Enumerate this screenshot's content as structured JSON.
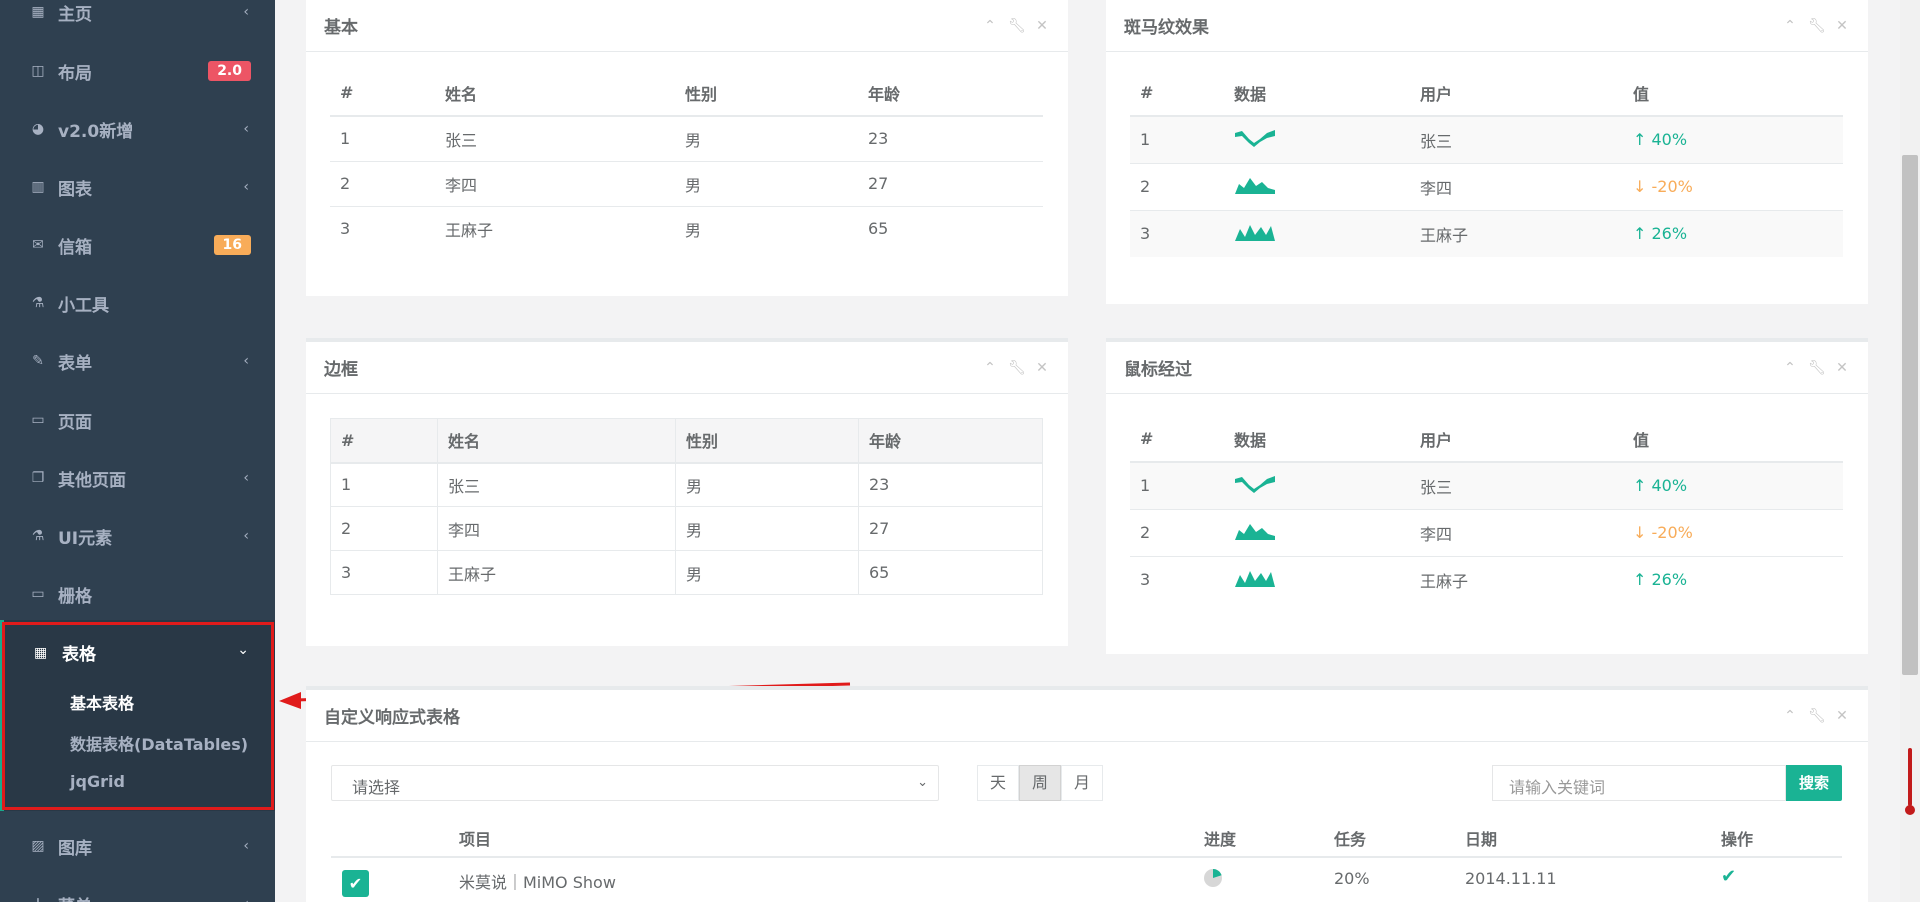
{
  "sidebar": {
    "items": [
      {
        "label": "主页",
        "icon": "grid-icon",
        "chevron": true
      },
      {
        "label": "布局",
        "icon": "columns-icon",
        "badge": "2.0",
        "badge_color": "#ed5565"
      },
      {
        "label": "v2.0新增",
        "icon": "globe-icon",
        "chevron": true
      },
      {
        "label": "图表",
        "icon": "bar-chart-icon",
        "chevron": true
      },
      {
        "label": "信箱",
        "icon": "envelope-icon",
        "badge": "16",
        "badge_color": "#f8ac59"
      },
      {
        "label": "小工具",
        "icon": "flask-icon"
      },
      {
        "label": "表单",
        "icon": "edit-icon",
        "chevron": true
      },
      {
        "label": "页面",
        "icon": "desktop-icon"
      },
      {
        "label": "其他页面",
        "icon": "files-icon",
        "chevron": true
      },
      {
        "label": "UI元素",
        "icon": "flask-icon",
        "chevron": true
      },
      {
        "label": "栅格",
        "icon": "laptop-icon"
      }
    ],
    "active": {
      "label": "表格",
      "icon": "table-icon",
      "children": [
        "基本表格",
        "数据表格(DataTables)",
        "jqGrid"
      ],
      "selected": "基本表格"
    },
    "after": [
      {
        "label": "图库",
        "icon": "picture-icon",
        "chevron": true
      },
      {
        "label": "菜单",
        "icon": "sitemap-icon",
        "chevron": true
      }
    ]
  },
  "panels": {
    "basic": {
      "title": "基本",
      "headers": [
        "#",
        "姓名",
        "性别",
        "年龄"
      ],
      "rows": [
        [
          "1",
          "张三",
          "男",
          "23"
        ],
        [
          "2",
          "李四",
          "男",
          "27"
        ],
        [
          "3",
          "王麻子",
          "男",
          "65"
        ]
      ]
    },
    "striped": {
      "title": "斑马纹效果",
      "headers": [
        "#",
        "数据",
        "用户",
        "值"
      ],
      "rows": [
        {
          "n": "1",
          "spark": "wave",
          "user": "张三",
          "value": "40%",
          "trend": "up"
        },
        {
          "n": "2",
          "spark": "mountain",
          "user": "李四",
          "value": "-20%",
          "trend": "down"
        },
        {
          "n": "3",
          "spark": "peaks",
          "user": "王麻子",
          "value": "26%",
          "trend": "up"
        }
      ]
    },
    "bordered": {
      "title": "边框",
      "headers": [
        "#",
        "姓名",
        "性别",
        "年龄"
      ],
      "rows": [
        [
          "1",
          "张三",
          "男",
          "23"
        ],
        [
          "2",
          "李四",
          "男",
          "27"
        ],
        [
          "3",
          "王麻子",
          "男",
          "65"
        ]
      ]
    },
    "hover": {
      "title": "鼠标经过",
      "headers": [
        "#",
        "数据",
        "用户",
        "值"
      ],
      "rows": [
        {
          "n": "1",
          "spark": "wave",
          "user": "张三",
          "value": "40%",
          "trend": "up"
        },
        {
          "n": "2",
          "spark": "mountain",
          "user": "李四",
          "value": "-20%",
          "trend": "down"
        },
        {
          "n": "3",
          "spark": "peaks",
          "user": "王麻子",
          "value": "26%",
          "trend": "up"
        }
      ]
    },
    "custom": {
      "title": "自定义响应式表格",
      "select_value": "请选择",
      "segments": [
        "天",
        "周",
        "月"
      ],
      "selected_segment": "周",
      "search_placeholder": "请输入关键词",
      "search_label": "搜索",
      "headers": [
        "项目",
        "进度",
        "任务",
        "日期",
        "操作"
      ],
      "rows": [
        {
          "project": "米莫说｜MiMO Show",
          "progress": 0.2,
          "task": "20%",
          "date": "2014.11.11",
          "checked": true
        }
      ]
    }
  },
  "colors": {
    "accent": "#1ab394",
    "sidebar": "#2f4050",
    "warning": "#f8ac59",
    "danger": "#ed5565"
  }
}
